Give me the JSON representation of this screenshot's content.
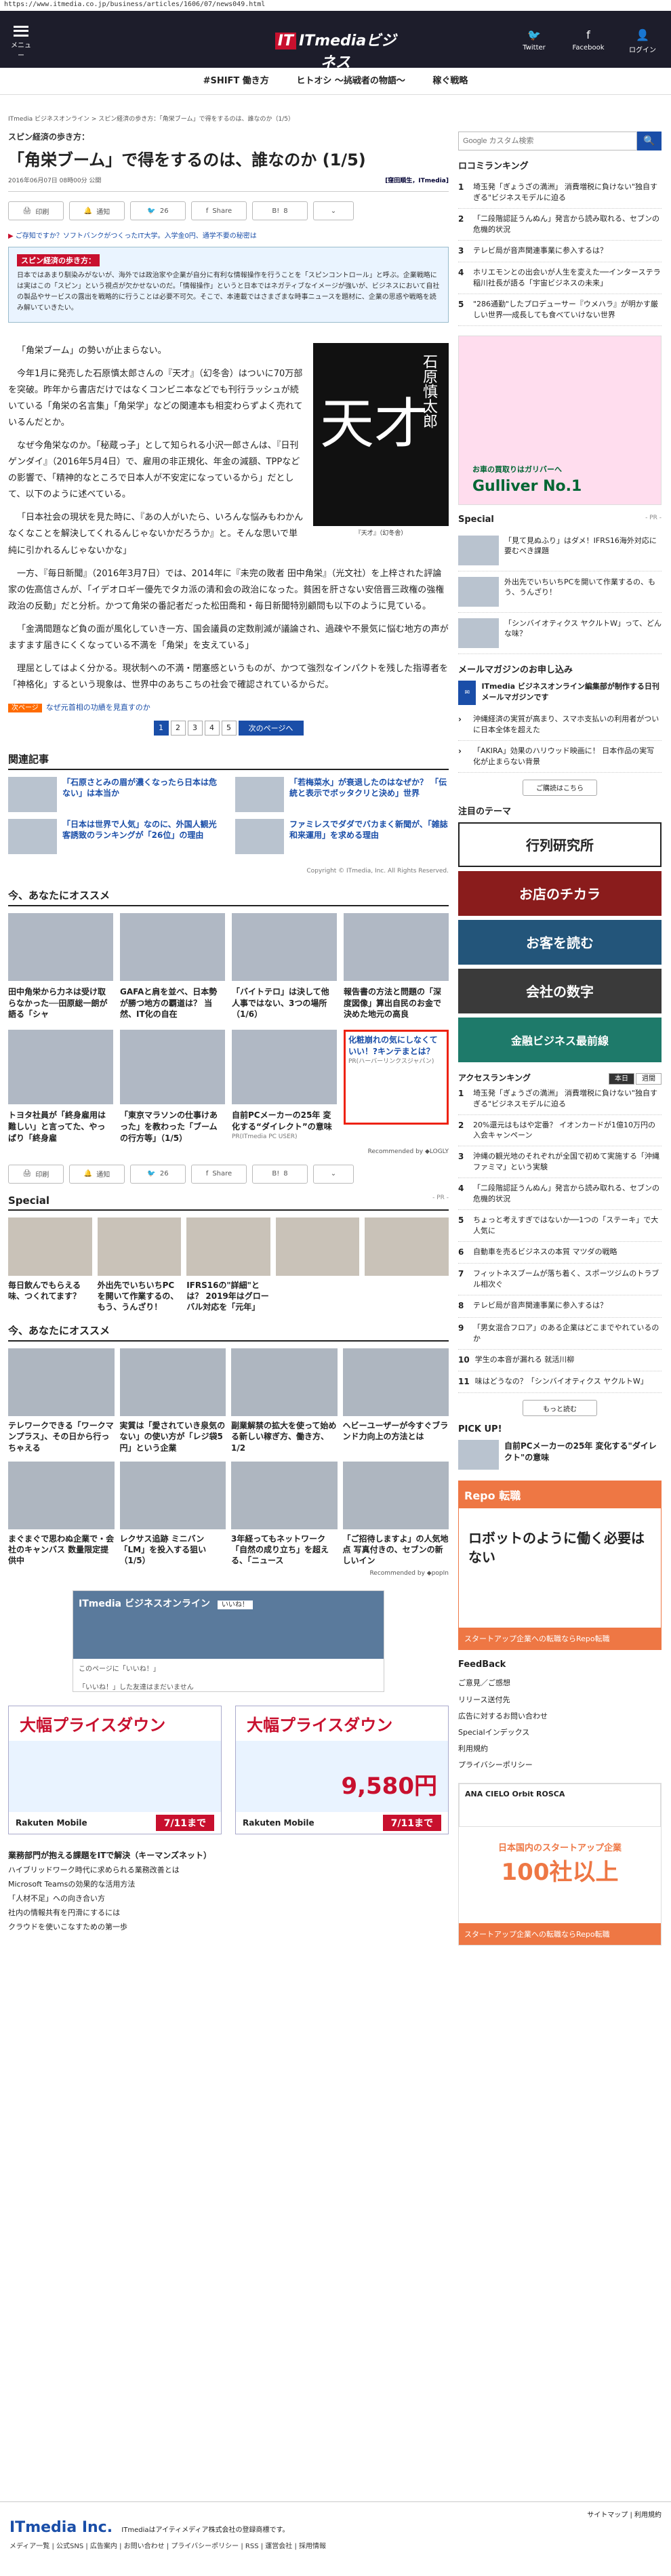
{
  "url": "https://www.itmedia.co.jp/business/articles/1606/07/news049.html",
  "header": {
    "menu": "メニュー",
    "logo_main": "ITmediaビジネス",
    "logo_it": "IT",
    "logo_sub": "ONLINE",
    "twitter": "Twitter",
    "facebook": "Facebook",
    "login": "ログイン"
  },
  "nav": [
    "#SHIFT 働き方",
    "ヒトオシ ～挑戦者の物語～",
    "稼ぐ戦略"
  ],
  "article": {
    "breadcrumb": "ITmedia ビジネスオンライン > スピン経済の歩き方：「角栄ブーム」で得をするのは、誰なのか（1/5）",
    "kicker": "スピン経済の歩き方：",
    "title": "「角栄ブーム」で得をするのは、誰なのか (1/5)",
    "date": "2016年06月07日 08時00分 公開",
    "author": "[窪田順生，ITmedia]",
    "share": {
      "print": "印刷",
      "notify": "通知",
      "tw": "26",
      "fb": "Share",
      "hb": "8"
    },
    "promo": "ご存知ですか？ソフトバンクがつくったIT大学。入学金0円、通学不要の秘密は",
    "promo_mark": "▶",
    "series_title": "スピン経済の歩き方：",
    "series_text": "日本ではあまり馴染みがないが、海外では政治家や企業が自分に有利な情報操作を行うことを「スピンコントロール」と呼ぶ。企業戦略には実はこの「スピン」という視点が欠かせないのだ。「情報操作」というと日本ではネガティブなイメージが強いが、ビジネスにおいて自社の製品やサービスの露出を戦略的に行うことは必要不可欠。そこで、本連載ではさまざまな時事ニュースを題材に、企業の思惑や戦略を読み解いていきたい。",
    "photo_big": "天才",
    "photo_author": "石原慎太郎",
    "photo_caption": "『天才』（幻冬舎）",
    "body": [
      "「角栄ブーム」の勢いが止まらない。",
      "今年1月に発売した石原慎太郎さんの『天才』（幻冬舎）はついに70万部を突破。昨年から書店だけではなくコンビニ本などでも刊行ラッシュが続いている「角栄の名言集」「角栄学」などの関連本も相変わらずよく売れているんだとか。",
      "なぜ今角栄なのか。「秘蔵っ子」として知られる小沢一郎さんは、『日刊ゲンダイ』（2016年5月4日）で、雇用の非正規化、年金の減額、TPPなどの影響で、「精神的なところで日本人が不安定になっているから」だとして、以下のように述べている。",
      "「日本社会の現状を見た時に、『あの人がいたら、いろんな悩みもわかんなくなことを解決してくれるんじゃないかだろうか』と。そんな思いで単純に引かれるんじゃないかな」",
      "一方、『毎日新聞』（2016年3月7日）では、2014年に『未完の敗者 田中角栄』（光文社）を上梓された評論家の佐高信さんが、「イデオロギー優先でタカ派の清和会の政治になった。貧困を肝さない安倍晋三政権の強権政治の反動」だと分析。かつて角栄の番記者だった松田喬和・毎日新聞特別顧問も以下のように見ている。",
      "「金満間題など負の面が風化していき一方、国会議員の定数削減が議論され、過疎や不景気に悩む地方の声がますます届きにくくなっている不満を「角栄」を支えている」",
      "理屈としてはよく分かる。現状制への不満・閉塞感というものが、かつて強烈なインパクトを残した指導者を「神格化」するという現象は、世界中のあちこちの社会で確認されているからだ。"
    ],
    "next_tag": "次ページ",
    "next_text": "なぜ元首相の功績を見直すのか",
    "pages": [
      "1",
      "2",
      "3",
      "4",
      "5"
    ],
    "next_btn": "次のページへ"
  },
  "related": {
    "title": "関連記事",
    "items": [
      "「石原さとみの眉が濃くなったら日本は危ない」は本当か",
      "「若梅菜水」が衰退したのはなぜか？ 「伝統と表示でボッタクリと決め」世界",
      "「日本は世界で人気」なのに、外国人観光客誘致のランキングが「26位」の理由",
      "ファミレスでダダでバカまく新聞が、「雑誌和来運用」を求める理由"
    ]
  },
  "copyright": "Copyright © ITmedia, Inc. All Rights Reserved.",
  "rec1": {
    "title": "今、あなたにオススメ",
    "items": [
      {
        "t": "田中角栄から力ネは受け取らなかった──田原総一朗が語る「シャ",
        "pr": ""
      },
      {
        "t": "GAFAと肩を並べ、日本勢が勝つ地方の覇道は？ 当然、IT化の自在",
        "pr": ""
      },
      {
        "t": "「バイトテロ」は決して他人事ではない、3つの場所（1/6）",
        "pr": ""
      },
      {
        "t": "報告書の方法と問題の「深度図像」算出自民のお金で決めた地元の高良",
        "pr": ""
      },
      {
        "t": "トヨタ社員が「終身雇用は難しい」と言ってた、やっぱり「終身雇",
        "pr": ""
      },
      {
        "t": "「東京マラソンの仕事けあった」を教わった「ブームの行方等」（1/5）",
        "pr": ""
      },
      {
        "t": "自前PCメーカーの25年 変化する“ダイレクト”の意味",
        "pr": "PR(ITmedia PC USER)"
      },
      {
        "t": "化粧崩れの気にしなくていい！?キンテまとは？",
        "pr": "PR(ハーバーリンクスジャパン)"
      }
    ],
    "logly": "Recommended by ◆LOGLY"
  },
  "share2": {
    "print": "印刷",
    "notify": "通知",
    "tw": "26",
    "fb": "Share",
    "hb": "8"
  },
  "special": {
    "title": "Special",
    "pr": "- PR -",
    "items": [
      "毎日飲んでもらえる味、つくれてます？",
      "外出先でいちいちPCを開いて作業するの、もう、うんざり！",
      "IFRS16の\"詳細\"とは？ 2019年はグローバル対応を「元年」",
      ""
    ]
  },
  "rec2": {
    "title": "今、あなたにオススメ",
    "items": [
      "テレワークできる「ワークマンプラス」、その日から行っちゃえる",
      "実質は「愛されていき泉気のない」の使い方が「レジ袋5円」という企業",
      "副業解禁の拡大を使って始める新しい稼ぎ方、働き方、1/2",
      "ヘビーユーザーが今すぐブランド力向上の方法とは",
      "まぐまぐで思わぬ企業で・会社のキャンバス 数量限定提供中",
      "レクサス追跡 ミニバン「LM」を投入する狙い（1/5）",
      "3年経ってもネットワーク「自然の成り立ち」を超える、「ニュース",
      "「ご招待しますよ」の人気地点 写真付きの、セブンの新しいイン"
    ],
    "popin": "Recommended by ◆popIn"
  },
  "fb": {
    "name": "ITmedia ビジネスオンライン",
    "likes": "いいね！",
    "btn": "このページに「いいね！」",
    "note": "「いいね！」した友達はまだいません"
  },
  "ads": [
    {
      "h": "大幅プライスダウン",
      "price": "",
      "btn": "7/11まで",
      "brand": "Rakuten Mobile"
    },
    {
      "h": "大幅プライスダウン",
      "price": "9,580円",
      "btn": "7/11まで",
      "brand": "Rakuten Mobile"
    }
  ],
  "tieups": {
    "title": "業務部門が抱える課題をITで解決（キーマンズネット）",
    "items": [
      "ハイブリッドワーク時代に求められる業務改善とは",
      "Microsoft Teamsの効果的な活用方法",
      "「人材不足」への向き合い方",
      "社内の情報共有を円滑にするには",
      "クラウドを使いこなすための第一歩"
    ]
  },
  "side": {
    "search_placeholder": "Google カスタム検索",
    "search_btn": "🔍",
    "ranking_title": "ロコミランキング",
    "ranking": [
      "埼玉発「ぎょうざの満洲」 消費増税に負けない\"独自すぎる\"ビジネスモデルに迫る",
      "「二段階認証うんぬん」発言から読み取れる、セブンの危機的状況",
      "テレビ局が音声関連事業に参入するは？",
      "ホリエモンとの出会いが人生を変えた──インターステラ稲川社長が語る「宇宙ビジネスの未来」",
      "\"286通勤\"したプロデューサー『ウメハラ』が明かす厳しい世界──成長しても食べていけない世界"
    ],
    "ad_car": {
      "brand": "Gulliver No.1",
      "t": "お車の買取りはガリバーへ"
    },
    "special_title": "Special",
    "special_pr": "- PR -",
    "special": [
      "「見て見ぬふり」はダメ！IFRS16海外対応に要むべき課題",
      "外出先でいちいちPCを開いて作業するの、もう、うんざり！",
      "「シンバイオティクス ヤクルトW」って、どんな味？"
    ],
    "mm_title": "メールマガジンのお申し込み",
    "mm_text": "ITmedia ビジネスオンライン編集部が制作する日刊メールマガジンです",
    "mm_list": [
      "沖縄経済の実質が高まり、スマホ支払いの利用者がついに日本全体を超えた",
      "「AKIRA」効果のハリウッド映画に！ 日本作品の実写化が止まらない背景"
    ],
    "mm_btn": "ご購読はこちら",
    "theme_title": "注目のテーマ",
    "themes": [
      "行列研究所",
      "お店のチカラ",
      "お客を読む",
      "会社の数字",
      "金融ビジネス最前線"
    ],
    "access_title": "アクセスランキング",
    "tab_today": "本日",
    "tab_week": "週間",
    "access": [
      "埼玉発「ぎょうざの満洲」 消費増税に負けない\"独自すぎる\"ビジネスモデルに迫る",
      "20%還元はもはや定番？ イオンカードが1億10万円の入会キャンペーン",
      "沖縄の観光地のそれぞれが全国で初めて実施する「沖縄ファミマ」という実験",
      "「二段階認証うんぬん」発言から読み取れる、セブンの危機的状況",
      "ちょっと考えすぎではないか──1つの「ステーキ」で大人気に",
      "自動車を売るビジネスの本質 マツダの戦略",
      "フィットネスブームが落ち着く、スポーツジムのトラブル相次ぐ",
      "テレビ局が音声関連事業に参入するは？",
      "「男女混合フロア」のある企業はどこまでやれているのか",
      "学生の本音が漏れる 就活川柳",
      "味はどうなの？「シンバイオティクス ヤクルトW」"
    ],
    "more_btn": "もっと読む",
    "pickup_title": "PICK UP!",
    "pickup": "自前PCメーカーの25年 変化する\"ダイレクト\"の意味",
    "ad_repo": {
      "a": "Repo",
      "b": "転職",
      "c": "ロボットのように働く必要はない",
      "d": "スタートアップ企業への転職ならRepo転職"
    },
    "feedback_title": "FeedBack",
    "feedback": [
      "ご意見／ご感想",
      "リリース送付先",
      "広告に対するお問い合わせ",
      "Specialインデックス",
      "利用規約",
      "プライバシーポリシー"
    ],
    "ad_repo2": {
      "logos": "ANA CIELO Orbit ROSCA",
      "t": "日本国内のスタートアップ企業",
      "n": "100社以上",
      "d": "スタートアップ企業への転職ならRepo転職"
    }
  },
  "footer": {
    "logo": "ITmedia Inc.",
    "desc": "ITmediaはアイティメディア株式会社の登録商標です。",
    "links": "メディア一覧 | 公式SNS | 広告案内 | お問い合わせ | プライバシーポリシー | RSS | 運営会社 | 採用情報",
    "sitemap": "サイトマップ | 利用規約"
  },
  "colors": {
    "brand_red": "#c8102e",
    "link": "#1a4ea8",
    "header_bg": "#1d1d2b"
  }
}
